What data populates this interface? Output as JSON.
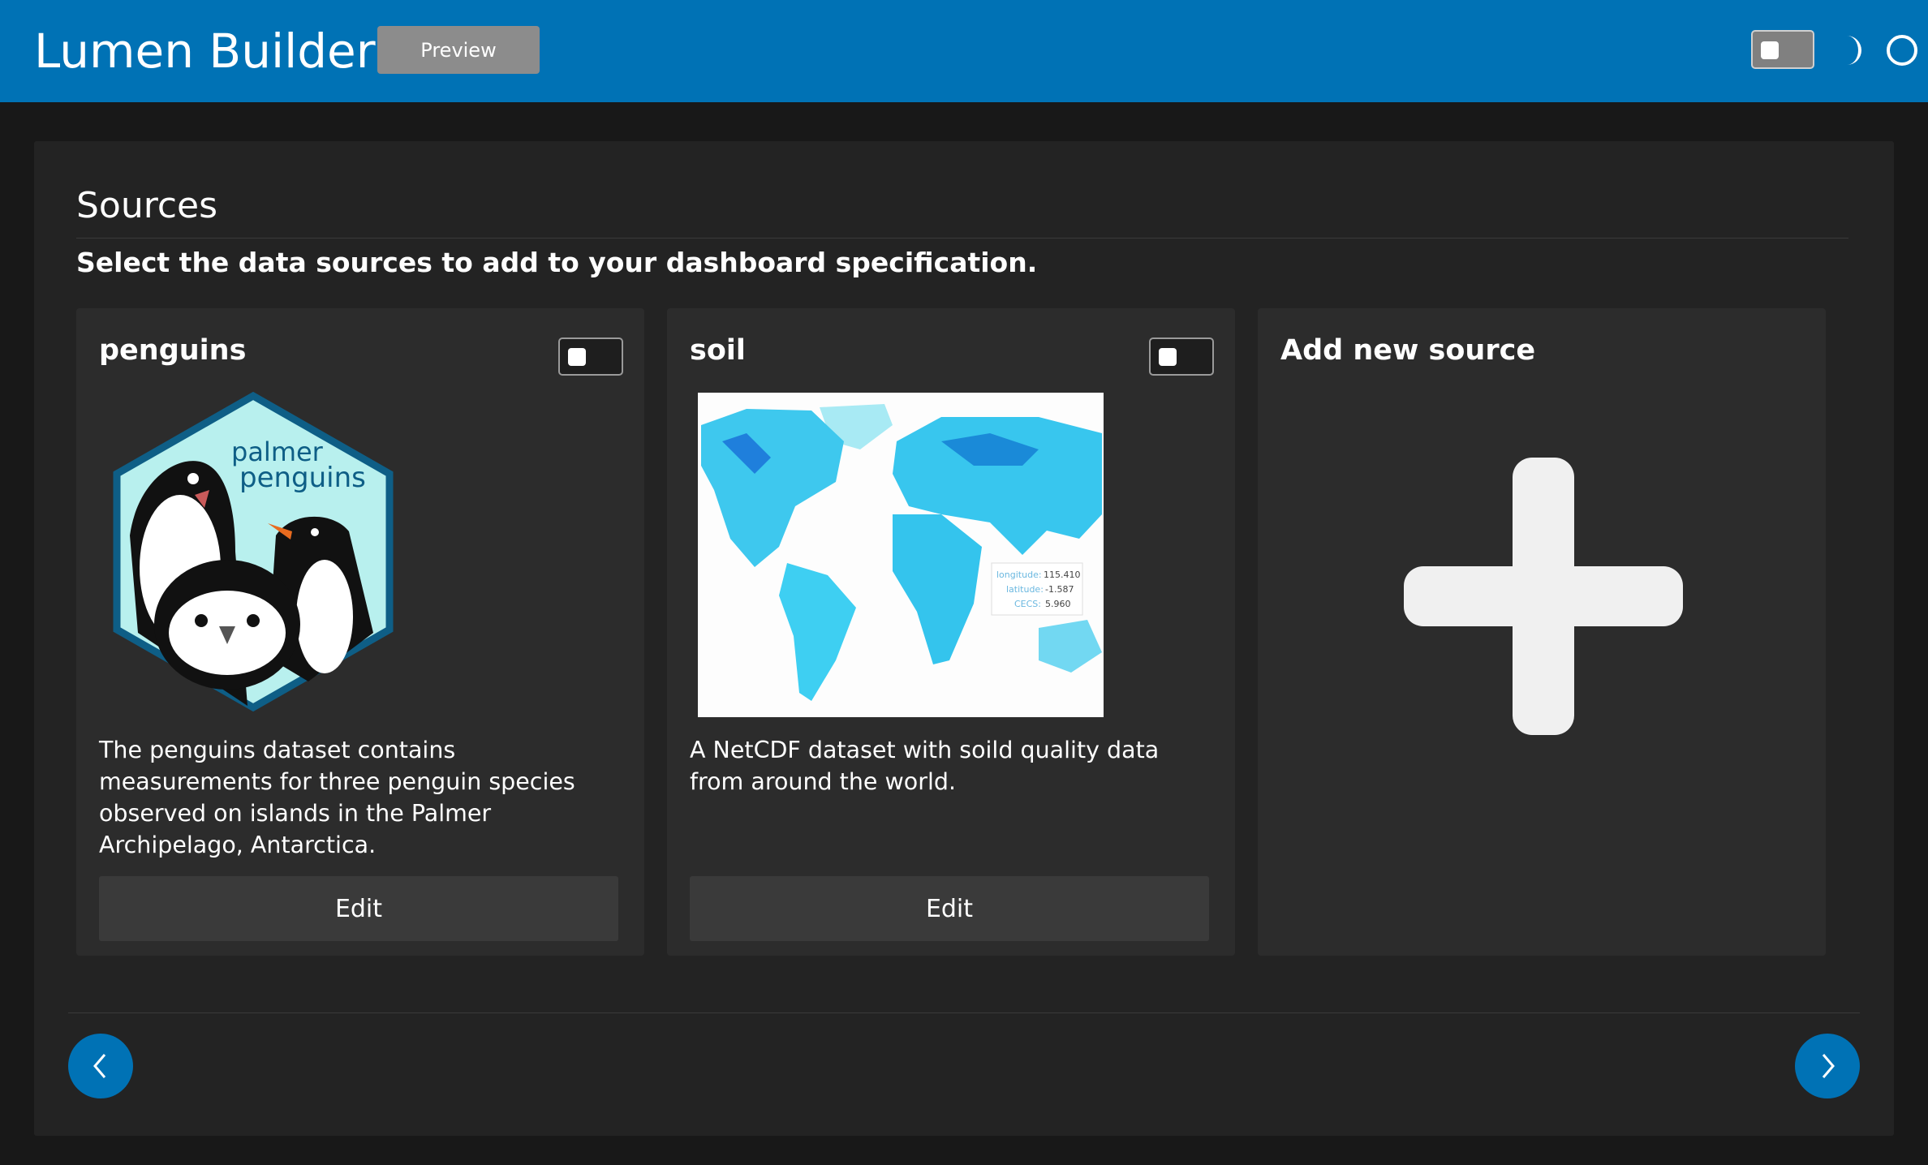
{
  "header": {
    "title": "Lumen Builder",
    "preview_label": "Preview",
    "theme_toggle_state": "off",
    "accent_color": "#0072b5"
  },
  "sources": {
    "title": "Sources",
    "subtitle": "Select the data sources to add to your dashboard specification.",
    "cards": [
      {
        "name": "penguins",
        "logo_text_line1": "palmer",
        "logo_text_line2": "penguins",
        "description": "The penguins dataset contains measurements for three penguin species observed on islands in the Palmer Archipelago, Antarctica.",
        "edit_label": "Edit",
        "selected": false
      },
      {
        "name": "soil",
        "description": "A NetCDF dataset with soild quality data from around the world.",
        "edit_label": "Edit",
        "selected": false,
        "map_tooltip": {
          "longitude_label": "longitude:",
          "longitude_value": "115.410",
          "latitude_label": "latitude:",
          "latitude_value": "-1.587",
          "cecs_label": "CECS:",
          "cecs_value": "5.960"
        }
      },
      {
        "name": "Add new source",
        "icon": "plus-icon"
      }
    ]
  },
  "navigation": {
    "prev_icon": "chevron-left-icon",
    "next_icon": "chevron-right-icon"
  }
}
